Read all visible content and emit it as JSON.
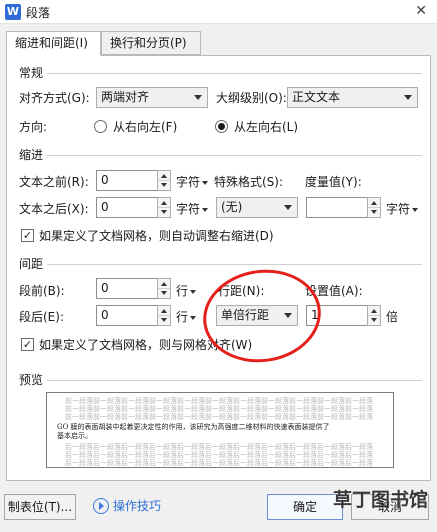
{
  "window": {
    "title": "段落",
    "app_icon_letter": "W"
  },
  "tabs": [
    {
      "label": "缩进和间距(I)"
    },
    {
      "label": "换行和分页(P)"
    }
  ],
  "general": {
    "title": "常规",
    "alignment_label": "对齐方式(G):",
    "alignment_value": "两端对齐",
    "outline_label": "大纲级别(O):",
    "outline_value": "正文文本",
    "direction_label": "方向:",
    "rtl_label": "从右向左(F)",
    "ltr_label": "从左向右(L)",
    "direction_selected": "ltr"
  },
  "indent": {
    "title": "缩进",
    "before_label": "文本之前(R):",
    "before_value": "0",
    "before_unit": "字符",
    "after_label": "文本之后(X):",
    "after_value": "0",
    "after_unit": "字符",
    "special_label": "特殊格式(S):",
    "special_value": "(无)",
    "measure_label": "度量值(Y):",
    "measure_value": "",
    "measure_unit": "字符",
    "grid_checkbox_label": "如果定义了文档网格，则自动调整右缩进(D)",
    "grid_checked": true
  },
  "spacing": {
    "title": "间距",
    "before_label": "段前(B):",
    "before_value": "0",
    "before_unit": "行",
    "after_label": "段后(E):",
    "after_value": "0",
    "after_unit": "行",
    "line_label": "行距(N):",
    "line_value": "单倍行距",
    "setting_label": "设置值(A):",
    "setting_value": "1",
    "setting_unit": "倍",
    "grid_checkbox_label": "如果定义了文档网格，则与网格对齐(W)",
    "grid_checked": true
  },
  "preview": {
    "title": "预览",
    "prev_lines": [
      "前一段落前一段落前一段落前一段落前一段落前一段落前一段落前一段落前一段落前一段落前一段落",
      "前一段落前一段落前一段落前一段落前一段落前一段落前一段落前一段落前一段落前一段落前一段落",
      "前一段落前一段落前一段落前一段落前一段落前一段落前一段落前一段落前一段落前一段落前一段落"
    ],
    "body_lines": [
      "GO 膜的表面胡装中起着更决定性的作用，该研究为高强度二维材料的快速表面装提供了",
      "基本启示。"
    ],
    "next_lines": [
      "后一段落后一段落后一段落后一段落后一段落后一段落后一段落后一段落后一段落后一段落后一段落",
      "后一段落后一段落后一段落后一段落后一段落后一段落后一段落后一段落后一段落后一段落后一段落",
      "后一段落后一段落后一段落后一段落后一段落后一段落后一段落后一段落后一段落后一段落后一段落"
    ]
  },
  "footer": {
    "tabstop_label": "制表位(T)...",
    "help_label": "操作技巧",
    "ok_label": "确定",
    "cancel_label": "取消"
  },
  "watermark": {
    "text": "草丁图书馆"
  },
  "colors": {
    "accent": "#2e6fd6",
    "annotation_circle": "#e5201b"
  }
}
